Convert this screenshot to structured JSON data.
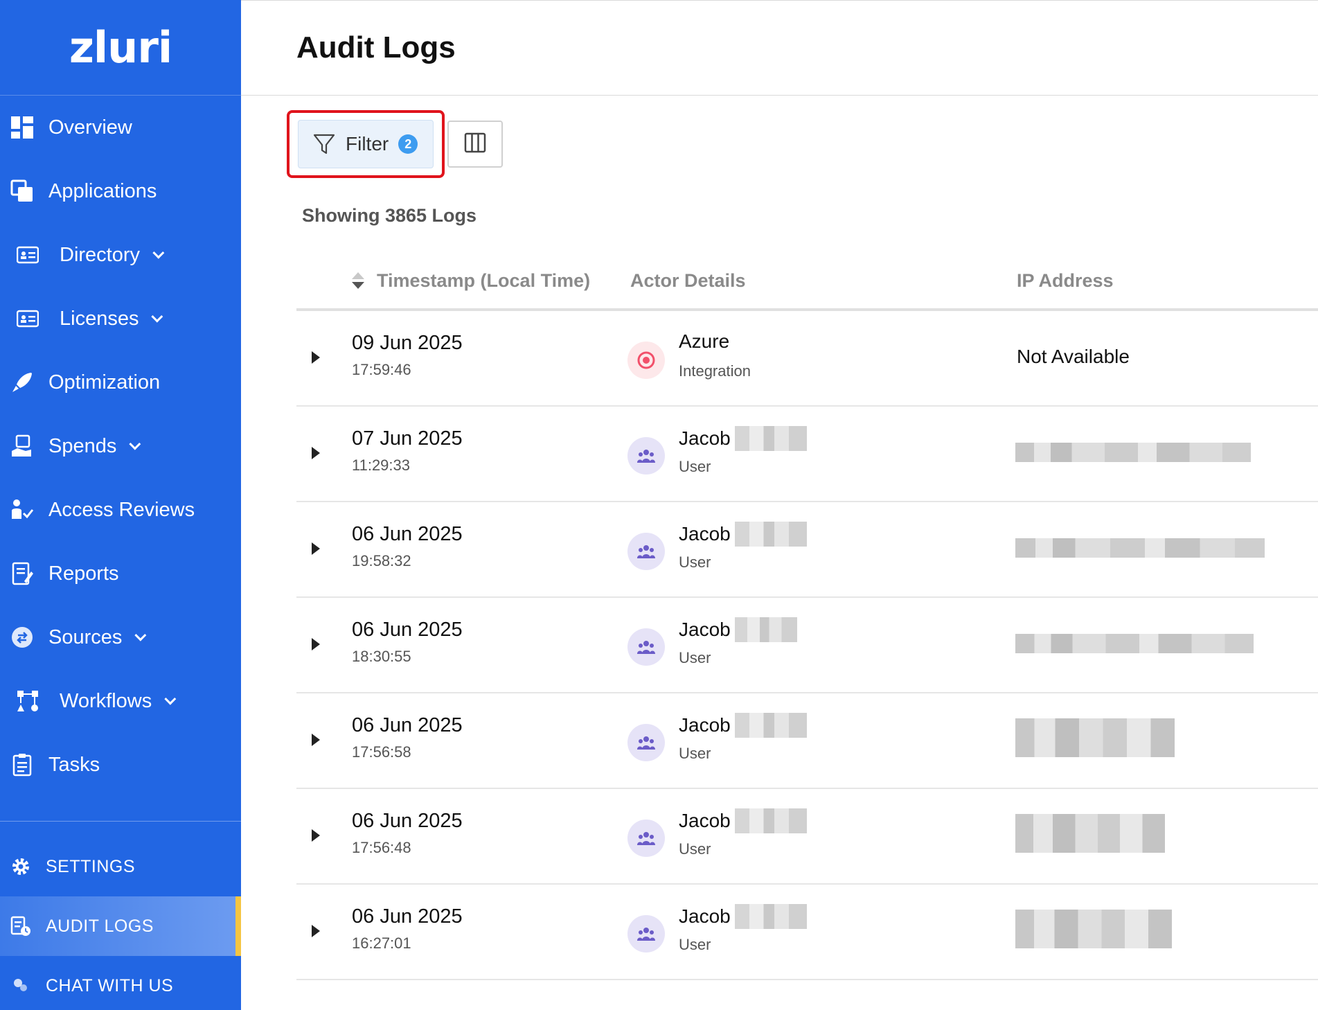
{
  "brand": {
    "logo_text": "zluri"
  },
  "sidebar": {
    "items": [
      {
        "label": "Overview",
        "icon": "dashboard-icon"
      },
      {
        "label": "Applications",
        "icon": "applications-icon"
      },
      {
        "label": "Directory",
        "icon": "directory-icon",
        "has_submenu": true
      },
      {
        "label": "Licenses",
        "icon": "licenses-icon",
        "has_submenu": true
      },
      {
        "label": "Optimization",
        "icon": "rocket-icon"
      },
      {
        "label": "Spends",
        "icon": "spends-icon",
        "has_submenu": true
      },
      {
        "label": "Access Reviews",
        "icon": "access-review-icon"
      },
      {
        "label": "Reports",
        "icon": "reports-icon"
      },
      {
        "label": "Sources",
        "icon": "sources-icon",
        "has_submenu": true
      },
      {
        "label": "Workflows",
        "icon": "workflows-icon",
        "has_submenu": true
      },
      {
        "label": "Tasks",
        "icon": "tasks-icon"
      }
    ],
    "bottom": [
      {
        "label": "SETTINGS",
        "icon": "gear-icon"
      },
      {
        "label": "AUDIT LOGS",
        "icon": "audit-log-icon",
        "active": true
      },
      {
        "label": "CHAT WITH US",
        "icon": "chat-icon"
      }
    ]
  },
  "header": {
    "title": "Audit Logs"
  },
  "toolbar": {
    "filter_label": "Filter",
    "filter_count": "2"
  },
  "summary": {
    "showing": "Showing 3865 Logs"
  },
  "table": {
    "columns": {
      "timestamp": "Timestamp (Local Time)",
      "actor": "Actor Details",
      "ip": "IP Address"
    },
    "rows": [
      {
        "date": "09 Jun 2025",
        "time": "17:59:46",
        "actor": "Azure",
        "role": "Integration",
        "ip": "Not Available"
      },
      {
        "date": "07 Jun 2025",
        "time": "11:29:33",
        "actor": "Jacob",
        "role": "User",
        "ip": ""
      },
      {
        "date": "06 Jun 2025",
        "time": "19:58:32",
        "actor": "Jacob",
        "role": "User",
        "ip": ""
      },
      {
        "date": "06 Jun 2025",
        "time": "18:30:55",
        "actor": "Jacob",
        "role": "User",
        "ip": ""
      },
      {
        "date": "06 Jun 2025",
        "time": "17:56:58",
        "actor": "Jacob",
        "role": "User",
        "ip": ""
      },
      {
        "date": "06 Jun 2025",
        "time": "17:56:48",
        "actor": "Jacob",
        "role": "User",
        "ip": ""
      },
      {
        "date": "06 Jun 2025",
        "time": "16:27:01",
        "actor": "Jacob",
        "role": "User",
        "ip": ""
      }
    ]
  },
  "colors": {
    "sidebar_bg": "#2266e3",
    "highlight_border": "#e0141c",
    "badge": "#3d9cf0",
    "active_marker": "#f5c542"
  }
}
